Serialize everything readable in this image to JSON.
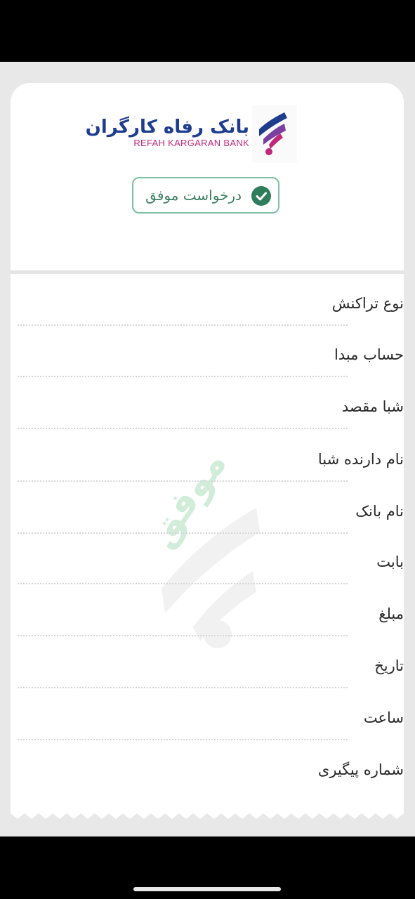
{
  "bank": {
    "name_fa": "بانک رفاه کارگران",
    "name_en": "REFAH KARGARAN BANK",
    "brand_blue": "#1e3d8f",
    "brand_magenta": "#c0287a"
  },
  "status": {
    "label": "درخواست موفق",
    "icon": "check-circle-icon",
    "color": "#2e7d5b"
  },
  "watermark": {
    "text": "موفق"
  },
  "fields": [
    {
      "label": "نوع تراکنش"
    },
    {
      "label": "حساب مبدا"
    },
    {
      "label": "شبا مقصد"
    },
    {
      "label": "نام دارنده شبا"
    },
    {
      "label": "نام بانک"
    },
    {
      "label": "بابت"
    },
    {
      "label": "مبلغ"
    },
    {
      "label": "تاریخ"
    },
    {
      "label": "ساعت"
    },
    {
      "label": "شماره پیگیری"
    }
  ]
}
